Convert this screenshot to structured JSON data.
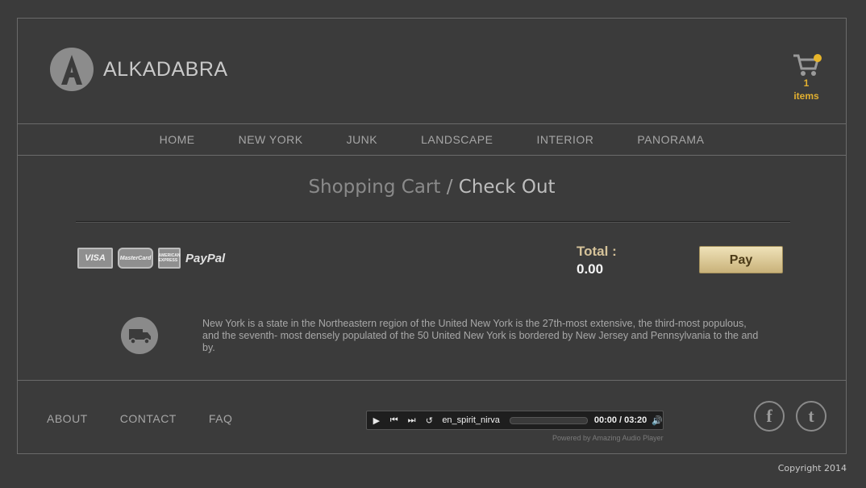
{
  "brand": {
    "name": "ALKADABRA"
  },
  "cart": {
    "count": "1",
    "label": "items"
  },
  "nav": {
    "items": [
      "HOME",
      "NEW YORK",
      "JUNK",
      "LANDSCAPE",
      "INTERIOR",
      "PANORAMA"
    ]
  },
  "page": {
    "title_part1": "Shopping Cart",
    "separator": " / ",
    "title_part2": "Check Out"
  },
  "payments": {
    "cards": [
      "VISA",
      "MasterCard",
      "AMERICAN EXPRESS",
      "PayPal"
    ]
  },
  "totals": {
    "label": "Total :",
    "value": "0.00"
  },
  "pay_button": {
    "label": "Pay"
  },
  "shipping": {
    "text": "New York is a state in the Northeastern region of the United New York is the 27th-most extensive, the third-most populous, and the seventh- most densely populated of the 50 United New York is bordered by New Jersey and Pennsylvania to the and by."
  },
  "footer": {
    "links": [
      "ABOUT",
      "CONTACT",
      "FAQ"
    ],
    "copyright": "Copyright 2014"
  },
  "player": {
    "track": "en_spirit_nirva",
    "time": "00:00 / 03:20",
    "powered": "Powered by Amazing Audio Player"
  },
  "social": {
    "facebook": "f",
    "twitter": "t"
  },
  "colors": {
    "accent": "#e2b030",
    "background": "#3b3b3b"
  }
}
